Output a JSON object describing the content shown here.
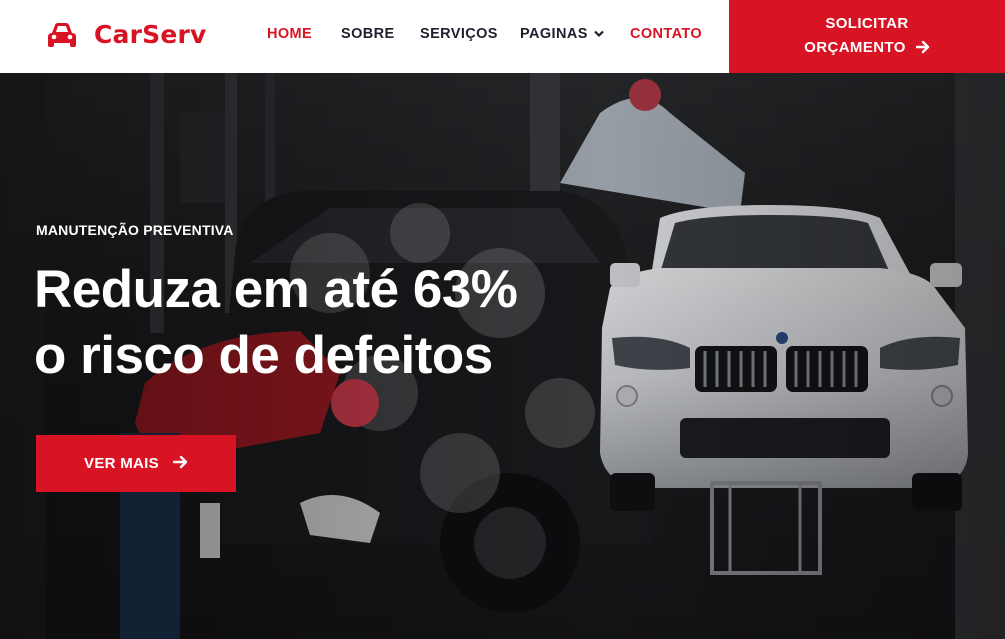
{
  "brand": {
    "name": "CarServ",
    "icon": "car-icon",
    "color": "#d81324"
  },
  "nav": {
    "items": [
      {
        "label": "HOME",
        "active": true
      },
      {
        "label": "SOBRE"
      },
      {
        "label": "SERVIÇOS"
      },
      {
        "label": "PAGINAS",
        "icon": "chevron-down-icon"
      },
      {
        "label": "CONTATO",
        "highlight": true
      }
    ]
  },
  "cta": {
    "line1": "SOLICITAR",
    "line2": "ORÇAMENTO",
    "icon": "arrow-right-icon"
  },
  "hero": {
    "subtitle": "MANUTENÇÃO PREVENTIVA",
    "title_line1": "Reduza em até 63%",
    "title_line2": "o risco de defeitos",
    "button_label": "VER MAIS",
    "button_icon": "arrow-right-icon"
  },
  "colors": {
    "accent": "#d81324",
    "nav_text": "#1f1f2e",
    "hero_text": "#ffffff"
  }
}
